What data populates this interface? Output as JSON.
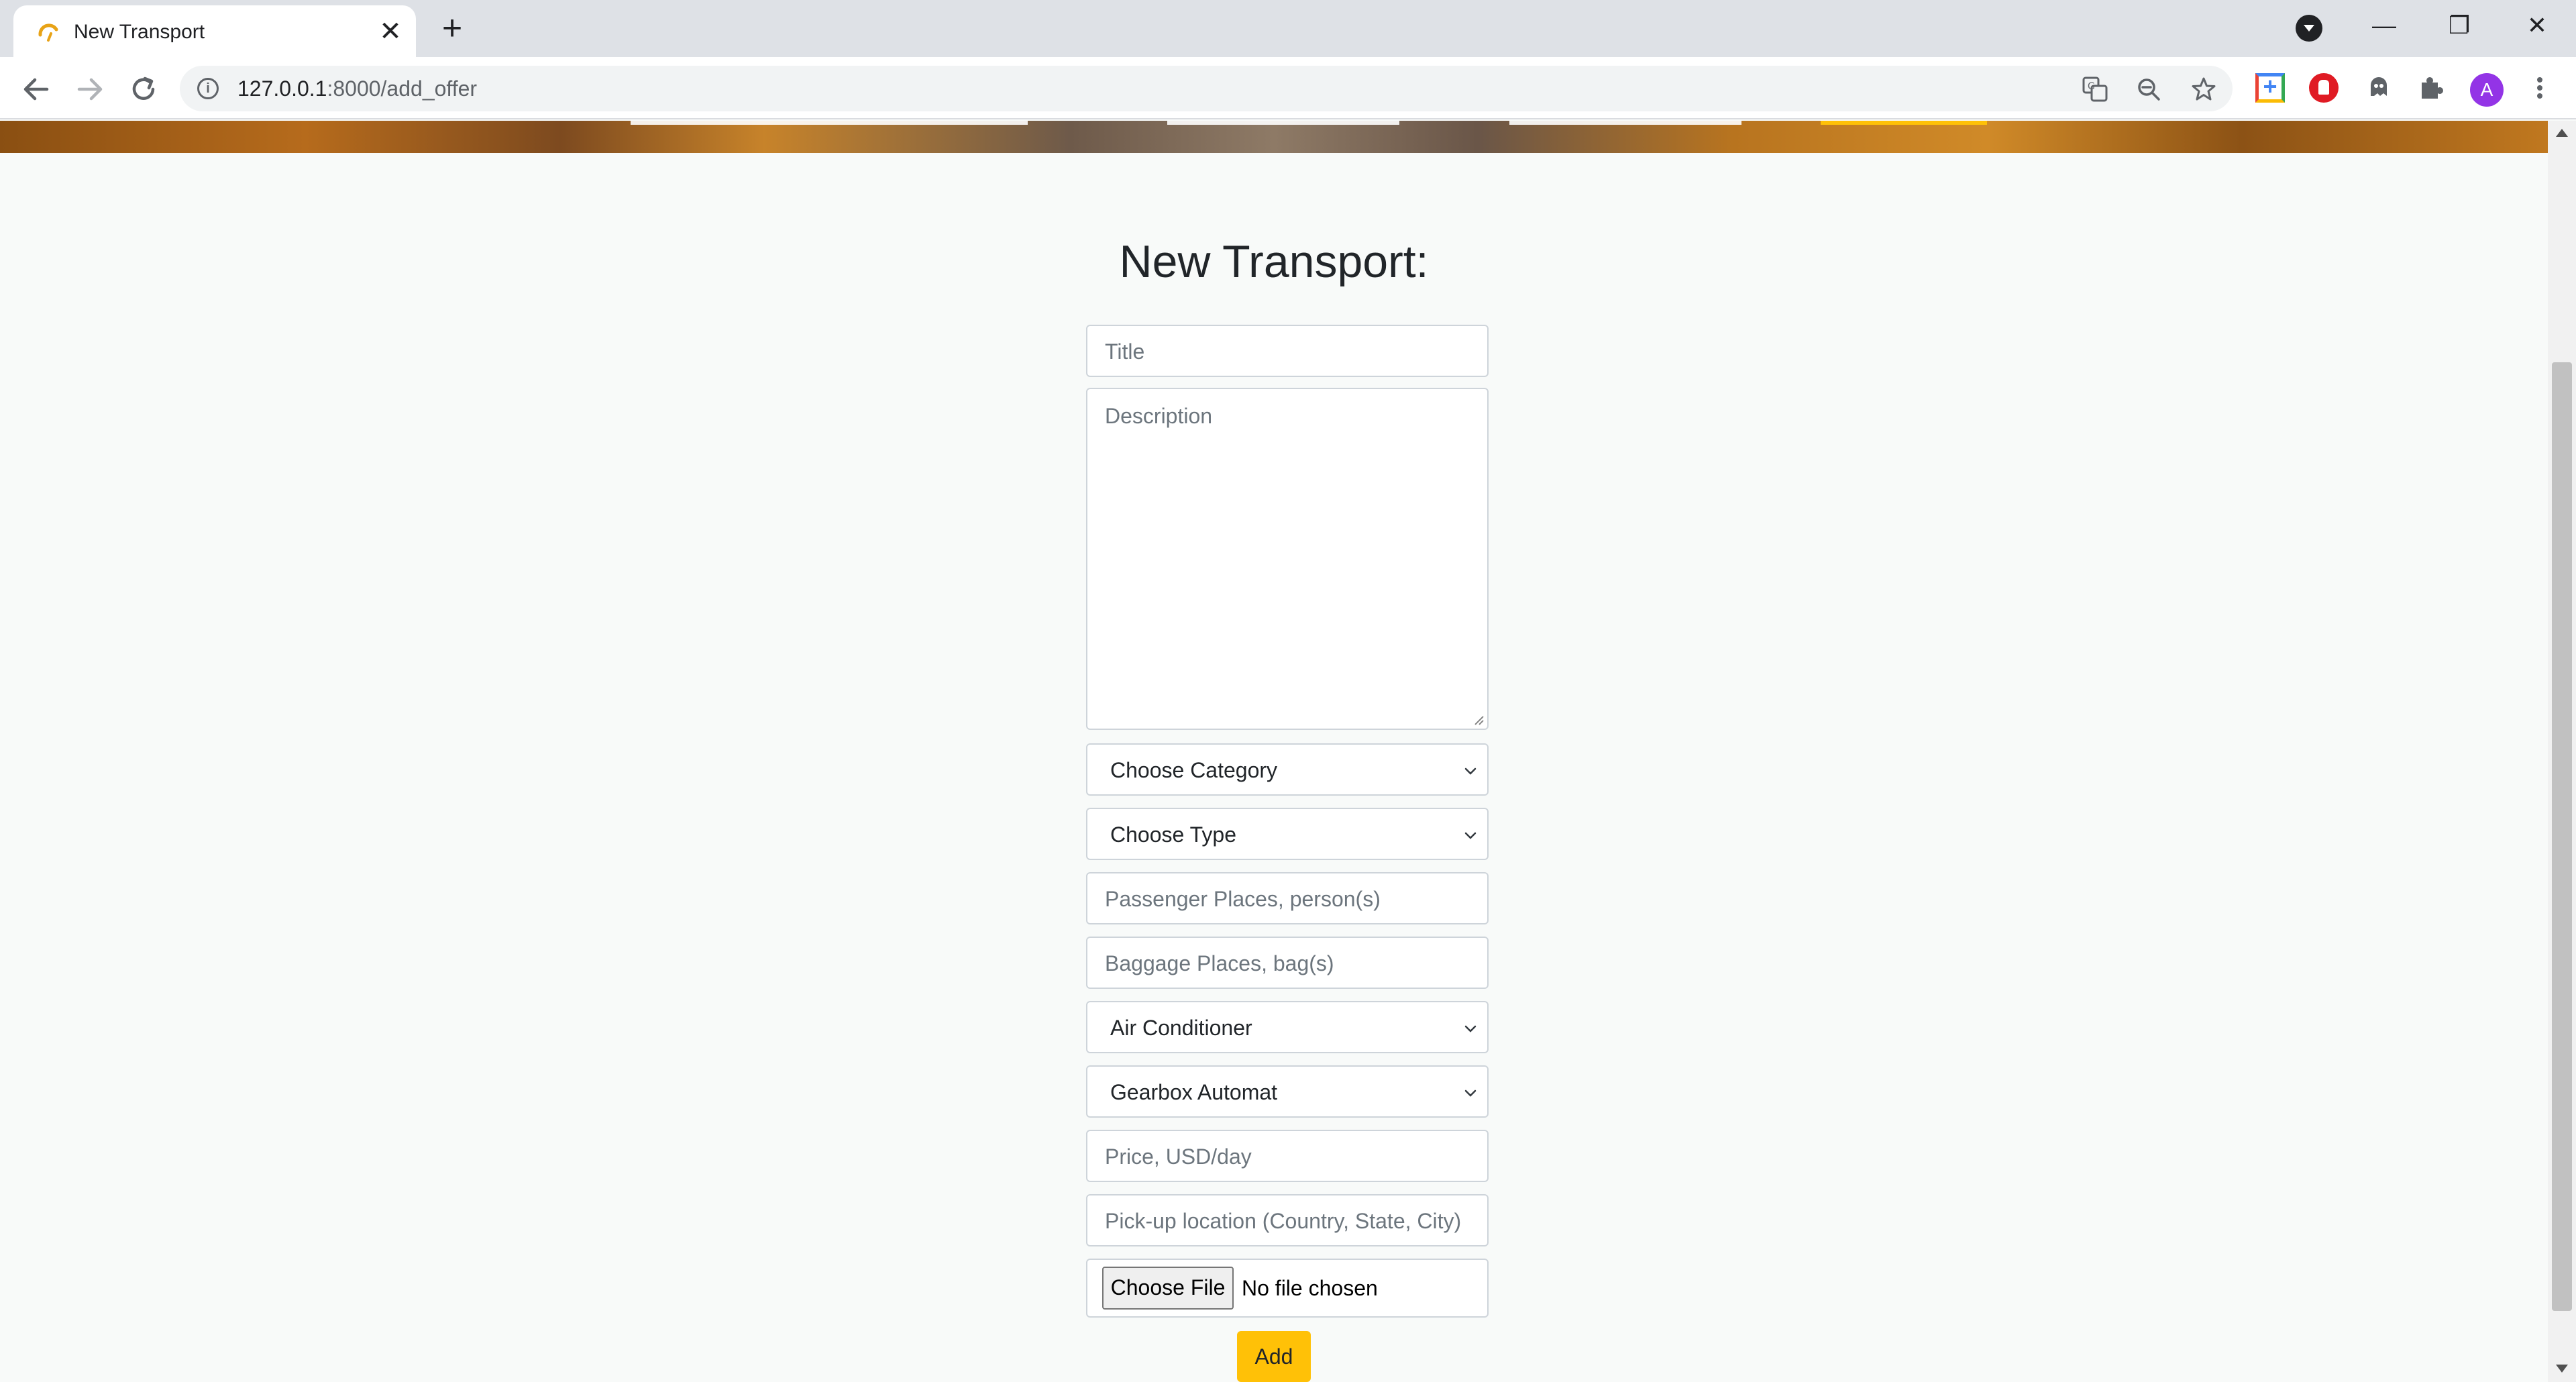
{
  "browser": {
    "tab_title": "New Transport",
    "new_tab_symbol": "+",
    "close_tab_symbol": "✕",
    "url_host": "127.0.0.1",
    "url_path": ":8000/add_offer",
    "avatar_letter": "A",
    "window_controls": {
      "minimize": "—",
      "restore": "❐",
      "close": "✕"
    }
  },
  "form": {
    "heading": "New Transport:",
    "title_placeholder": "Title",
    "description_placeholder": "Description",
    "category_select": "Choose Category",
    "type_select": "Choose Type",
    "passenger_placeholder": "Passenger Places, person(s)",
    "baggage_placeholder": "Baggage Places, bag(s)",
    "air_conditioner_select": "Air Conditioner",
    "gearbox_select": "Gearbox Automat",
    "price_placeholder": "Price, USD/day",
    "location_placeholder": "Pick-up location (Country, State, City)",
    "file_button": "Choose File",
    "file_status": "No file chosen",
    "submit_label": "Add"
  },
  "colors": {
    "accent": "#ffc107",
    "page_background": "#f8faf9",
    "input_border": "#ced4da",
    "placeholder": "#6c757d"
  }
}
